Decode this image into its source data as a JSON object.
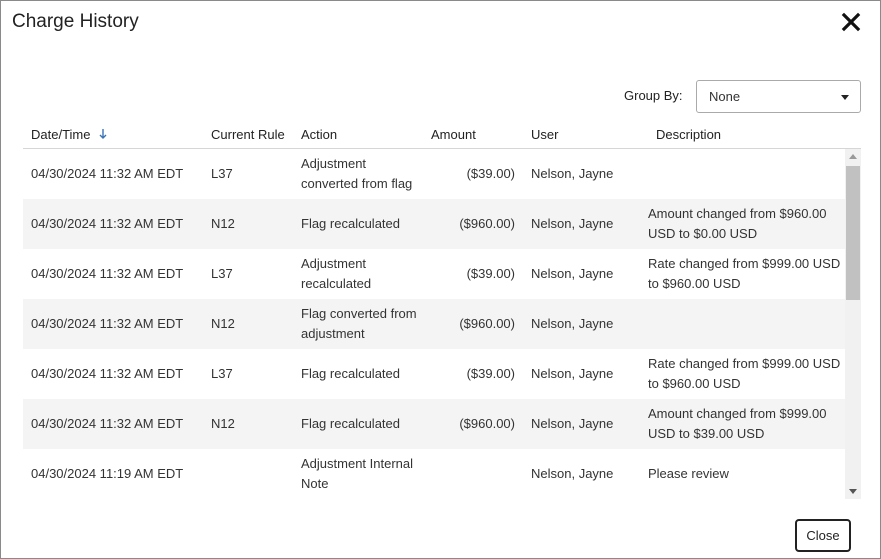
{
  "dialog": {
    "title": "Charge History",
    "close_button": "Close",
    "close_icon": "close-icon"
  },
  "group_by": {
    "label": "Group By:",
    "selected": "None"
  },
  "columns": {
    "date_time": "Date/Time",
    "current_rule": "Current Rule",
    "action": "Action",
    "amount": "Amount",
    "user": "User",
    "description": "Description",
    "sort_icon": "sort-descending-arrow-icon"
  },
  "rows": [
    {
      "date_time": "04/30/2024 11:32 AM EDT",
      "rule": "L37",
      "action": "Adjustment converted from flag",
      "amount": "($39.00)",
      "user": "Nelson, Jayne",
      "description": ""
    },
    {
      "date_time": "04/30/2024 11:32 AM EDT",
      "rule": "N12",
      "action": "Flag recalculated",
      "amount": "($960.00)",
      "user": "Nelson, Jayne",
      "description": "Amount changed from $960.00 USD to $0.00 USD"
    },
    {
      "date_time": "04/30/2024 11:32 AM EDT",
      "rule": "L37",
      "action": "Adjustment recalculated",
      "amount": "($39.00)",
      "user": "Nelson, Jayne",
      "description": "Rate changed from $999.00 USD to $960.00 USD"
    },
    {
      "date_time": "04/30/2024 11:32 AM EDT",
      "rule": "N12",
      "action": "Flag converted from adjustment",
      "amount": "($960.00)",
      "user": "Nelson, Jayne",
      "description": ""
    },
    {
      "date_time": "04/30/2024 11:32 AM EDT",
      "rule": "L37",
      "action": "Flag recalculated",
      "amount": "($39.00)",
      "user": "Nelson, Jayne",
      "description": "Rate changed from $999.00 USD to $960.00 USD"
    },
    {
      "date_time": "04/30/2024 11:32 AM EDT",
      "rule": "N12",
      "action": "Flag recalculated",
      "amount": "($960.00)",
      "user": "Nelson, Jayne",
      "description": "Amount changed from $999.00 USD to $39.00 USD"
    },
    {
      "date_time": "04/30/2024 11:19 AM EDT",
      "rule": "",
      "action": "Adjustment Internal Note",
      "amount": "",
      "user": "Nelson, Jayne",
      "description": "Please review"
    }
  ],
  "colors": {
    "sort_arrow": "#3b73b9",
    "row_alt_bg": "#f4f4f4"
  }
}
